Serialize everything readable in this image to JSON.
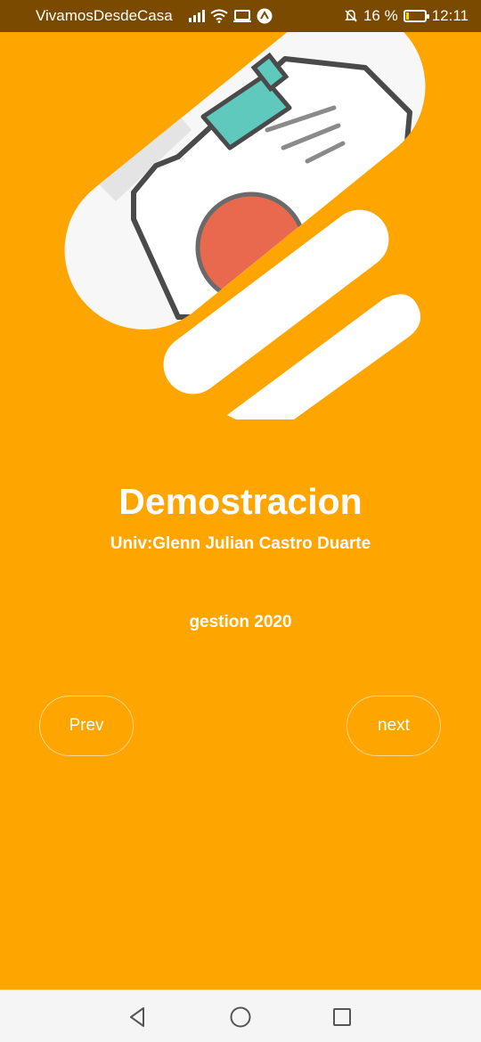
{
  "status_bar": {
    "carrier": "VivamosDesdeCasa",
    "battery_percent": "16 %",
    "time": "12:11",
    "icons": [
      "signal-icon",
      "wifi-icon",
      "cast-icon",
      "app-notification-icon",
      "mute-icon",
      "battery-icon"
    ]
  },
  "onboarding": {
    "illustration": "id-badge-illustration",
    "title": "Demostracion",
    "subtitle": "Univ:Glenn Julian Castro Duarte",
    "year": "gestion 2020",
    "prev_label": "Prev",
    "next_label": "next"
  },
  "navigation_bar": {
    "icons": [
      "back-icon",
      "home-icon",
      "recents-icon"
    ]
  },
  "colors": {
    "background": "#FFA500",
    "status_bar": "#7A4A00",
    "text": "#FFFFFF",
    "badge_clip": "#5FC9BE",
    "avatar": "#E8694E"
  }
}
